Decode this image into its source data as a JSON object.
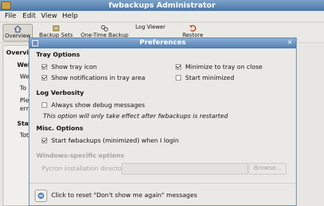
{
  "window": {
    "title": "fwbackups Administrator"
  },
  "menubar": {
    "file": "File",
    "edit": "Edit",
    "view": "View",
    "help": "Help"
  },
  "toolbar": {
    "overview": "Overview",
    "backup_sets": "Backup Sets",
    "operations": "One-Time Backup",
    "restore": "Restore",
    "log_viewer": "Log Viewer"
  },
  "background": {
    "overview_heading": "Overvi",
    "welcome_heading": "Welc",
    "welcome_text": "We",
    "line2": "To",
    "line3": "Plea",
    "line4": "erro",
    "status_heading": "Sta",
    "total": "Tota"
  },
  "dialog": {
    "title": "Preferences",
    "tray_options": {
      "heading": "Tray Options",
      "show_tray_icon": {
        "label": "Show tray icon",
        "checked": true
      },
      "show_notifications": {
        "label": "Show notifications in tray area",
        "checked": true
      },
      "minimize_to_tray": {
        "label": "Minimize to tray on close",
        "checked": true
      },
      "start_minimized": {
        "label": "Start minimized",
        "checked": false
      }
    },
    "log_verbosity": {
      "heading": "Log Verbosity",
      "debug_messages": {
        "label": "Always show debug messages",
        "checked": false
      },
      "note": "This option will only take effect after fwbackups is restarted"
    },
    "misc_options": {
      "heading": "Misc. Options",
      "start_at_login": {
        "label": "Start fwbackups (minimized) when I login",
        "checked": true
      }
    },
    "windows_options": {
      "heading": "Windows-specific options",
      "pycron_label": "Pycron installation directory:",
      "pycron_value": "",
      "browse_label": "Browse..."
    },
    "reset_label": "Click to reset \"Don't show me again\" messages"
  }
}
